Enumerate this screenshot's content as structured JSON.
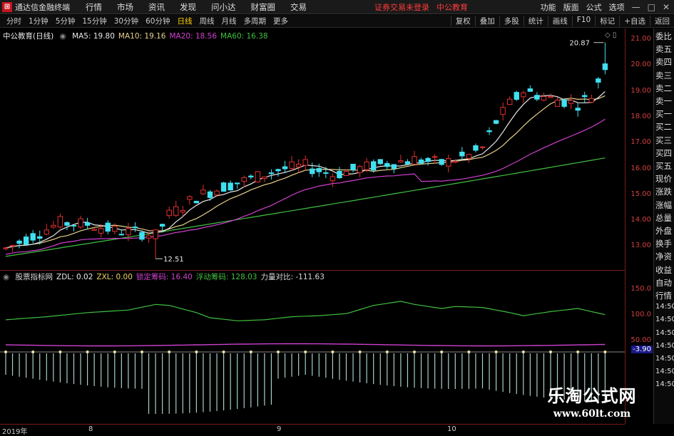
{
  "titlebar": {
    "app_name": "通达信金融终端",
    "menu": [
      "行情",
      "市场",
      "资讯",
      "发现",
      "问小达",
      "财富圈",
      "交易"
    ],
    "warning": "证券交易未登录",
    "stock_name": "中公教育",
    "right_menu": [
      "功能",
      "版面",
      "公式",
      "选项"
    ],
    "win_min": "—",
    "win_max": "□",
    "win_close": "✕"
  },
  "timeframes": [
    {
      "label": "分时"
    },
    {
      "label": "1分钟"
    },
    {
      "label": "5分钟"
    },
    {
      "label": "15分钟"
    },
    {
      "label": "30分钟"
    },
    {
      "label": "60分钟"
    },
    {
      "label": "日线",
      "active": true
    },
    {
      "label": "周线"
    },
    {
      "label": "月线"
    },
    {
      "label": "多周期"
    },
    {
      "label": "更多"
    }
  ],
  "right_tools": [
    "复权",
    "叠加",
    "多股",
    "统计",
    "画线",
    "F10",
    "标记",
    "+自选",
    "返回"
  ],
  "main_legend": {
    "title": "中公教育(日线)",
    "items": [
      {
        "text": "MA5: 19.80",
        "color": "#e8e8e8"
      },
      {
        "text": "MA10: 19.16",
        "color": "#e8d28a"
      },
      {
        "text": "MA20: 18.56",
        "color": "#d040d0"
      },
      {
        "text": "MA60: 16.38",
        "color": "#40c040"
      }
    ]
  },
  "price_axis": [
    "21.00",
    "20.00",
    "19.00",
    "18.00",
    "17.00",
    "16.00",
    "15.00",
    "14.00",
    "13.00"
  ],
  "annotations": {
    "high": "20.87",
    "low": "12.51"
  },
  "sub_legend": {
    "items": [
      {
        "text": "股票指标网",
        "color": "#d8d8d8"
      },
      {
        "text": "ZDL: 0.02",
        "color": "#e8e8e8"
      },
      {
        "text": "ZXL: 0.00",
        "color": "#e8d060"
      },
      {
        "text": "锁定筹码: 16.40",
        "color": "#d040d0"
      },
      {
        "text": "浮动筹码: 128.03",
        "color": "#40c040"
      },
      {
        "text": "力量对比: -111.63",
        "color": "#d8d8d8"
      }
    ]
  },
  "sub_axis": [
    "150.0",
    "100.0",
    "50.00"
  ],
  "sub_axis_badge": "-3.90",
  "date_axis": [
    "2019年",
    "8",
    "9",
    "10"
  ],
  "side_panel": [
    "委比",
    "卖五",
    "卖四",
    "卖三",
    "卖二",
    "卖一",
    "买一",
    "买二",
    "买三",
    "买四",
    "买五",
    "现价",
    "涨跌",
    "涨幅",
    "总量",
    "外盘",
    "换手",
    "净资",
    "收益",
    "自动",
    "行情",
    "14:50",
    "14:50",
    "14:50",
    "14:50",
    "14:50",
    "14:50",
    "14:50"
  ],
  "watermark": {
    "line1": "乐淘公式网",
    "line2": "www.60lt.com"
  },
  "colors": {
    "up": "#e03030",
    "down": "#40e0f0",
    "ma5": "#e8e8e8",
    "ma10": "#e8d28a",
    "ma20": "#d040d0",
    "ma60": "#40c040"
  }
}
